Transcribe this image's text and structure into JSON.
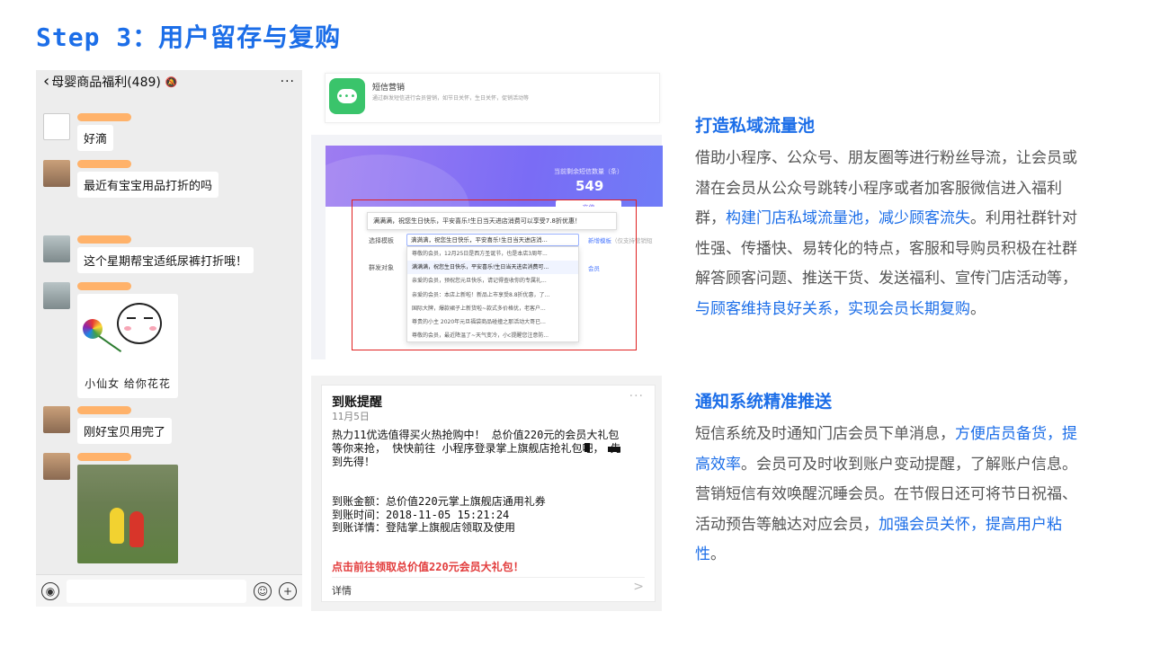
{
  "title": "Step 3：用户留存与复购",
  "chat": {
    "group_name": "母婴商品福利(489)",
    "messages": [
      "好滴",
      "最近有宝宝用品打折的吗",
      "这个星期帮宝适纸尿裤打折哦！",
      "刚好宝贝用完了"
    ],
    "sticker_text": "小仙女 给你花花"
  },
  "sms": {
    "title": "短信营销",
    "desc": "通过群发短信进行会员营销，如节日关怀，生日关怀，促销活动等",
    "quota_label": "当前剩余短信数量（条）",
    "quota_value": "549",
    "recharge": "充值",
    "tooltip": "满满满，祝您生日快乐，平安喜乐!生日当天进店消费可以享受7.8折优惠！",
    "select_label": "选择模板",
    "select_value": "满满满，祝您生日快乐，平安喜乐!生日当天进店消...",
    "new_template": "新增模板",
    "new_template_note": "（仅支持营销短",
    "target_label": "群发对象",
    "target_link": "会员",
    "options": [
      "尊敬的会员，12月25日是西方圣诞节，也是本店3周年...",
      "满满满，祝您生日快乐，平安喜乐!生日当天进店消费可...",
      "亲爱的会员，预祝您元旦快乐，请记得查收你的专属礼...",
      "亲爱的会员：本店上新啦！新品上市享受8.8折优惠，了...",
      "国际大牌，爆款裙子上新货啦~款式多价格优，老客户...",
      "尊贵的小主 2020年元旦福袋商品碰撞之那活动大哥已...",
      "尊敬的会员，最近降温了~天气变冷，小c提醒您注意防..."
    ]
  },
  "notice": {
    "title": "到账提醒",
    "date": "11月5日",
    "body": "热力11优选值得买火热抢购中！ 总价值220元的会员大礼包等你来抢， 快快前往 小程序登录掌上旗舰店抢礼包吧， 先到先得！",
    "fields": [
      {
        "k": "到账金额：",
        "v": "总价值220元掌上旗舰店通用礼券"
      },
      {
        "k": "到账时间：",
        "v": "2018-11-05 15:21:24"
      },
      {
        "k": "到账详情：",
        "v": "登陆掌上旗舰店领取及使用"
      }
    ],
    "cta": "点击前往领取总价值220元会员大礼包！",
    "detail": "详情",
    "arrow": ">"
  },
  "sections": [
    {
      "title": "打造私域流量池",
      "p1": "借助小程序、公众号、朋友圈等进行粉丝导流，让会员或潜在会员从公众号跳转小程序或者加客服微信进入福利群，",
      "h1": "构建门店私域流量池，减少顾客流失",
      "p2": "。利用社群针对性强、传播快、易转化的特点，客服和导购员积极在社群解答顾客问题、推送干货、发送福利、宣传门店活动等，",
      "h2": "与顾客维持良好关系，实现会员长期复购",
      "p3": "。"
    },
    {
      "title": "通知系统精准推送",
      "p1": "短信系统及时通知门店会员下单消息，",
      "h1": "方便店员备货，提高效率",
      "p2": "。会员可及时收到账户变动提醒，了解账户信息。营销短信有效唤醒沉睡会员。在节假日还可将节日祝福、活动预告等触达对应会员，",
      "h2": "加强会员关怀，提高用户粘性",
      "p3": "。"
    }
  ],
  "colors": {
    "accent": "#1c6ee8",
    "red": "#e02020",
    "sms_green": "#3ac46b",
    "quota_purple": "#7a6cf5"
  }
}
